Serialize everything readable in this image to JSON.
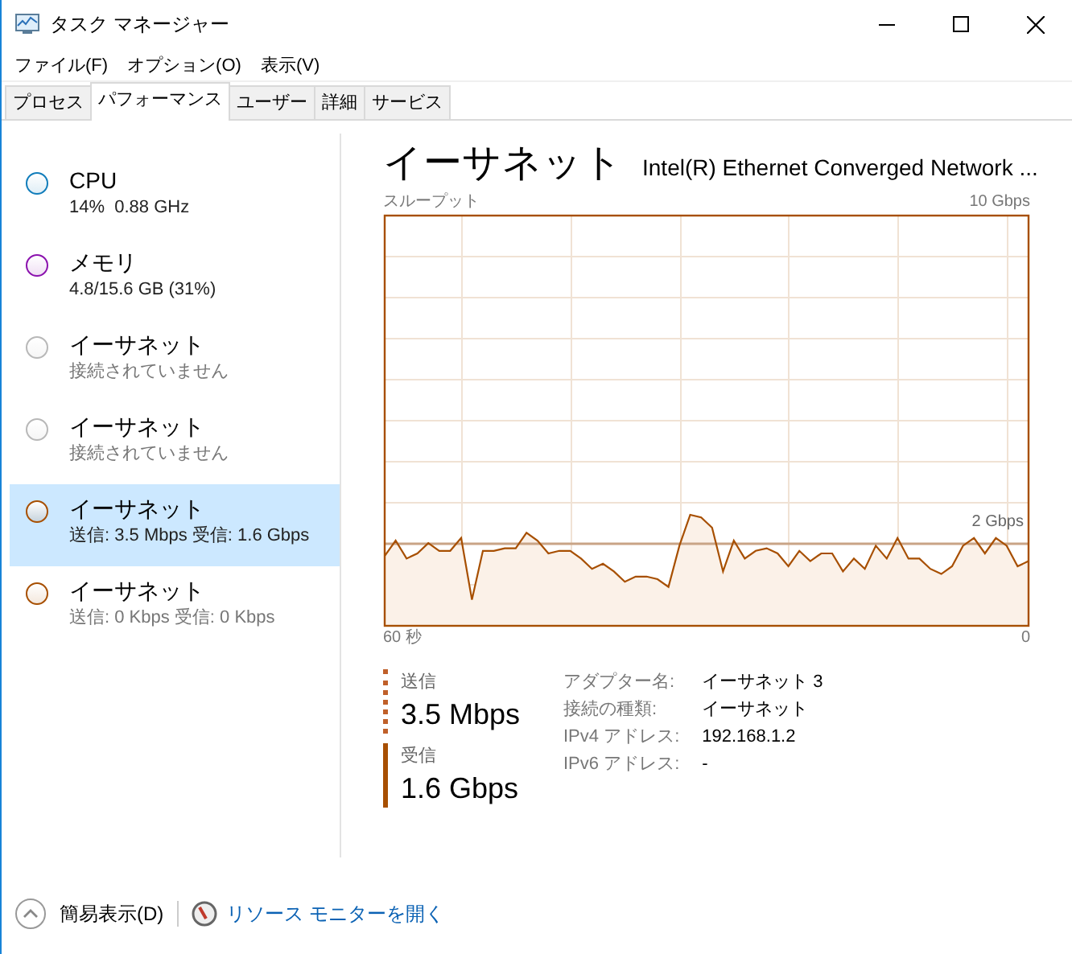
{
  "window": {
    "title": "タスク マネージャー"
  },
  "menu": [
    "ファイル(F)",
    "オプション(O)",
    "表示(V)"
  ],
  "tabs": [
    {
      "label": "プロセス",
      "selected": false
    },
    {
      "label": "パフォーマンス",
      "selected": true
    },
    {
      "label": "ユーザー",
      "selected": false
    },
    {
      "label": "詳細",
      "selected": false
    },
    {
      "label": "サービス",
      "selected": false
    }
  ],
  "sidebar": {
    "items": [
      {
        "name": "CPU",
        "detail": "14%  0.88 GHz",
        "color": "#117dbb",
        "muted": false,
        "selected": false
      },
      {
        "name": "メモリ",
        "detail": "4.8/15.6 GB (31%)",
        "color": "#8b12ae",
        "muted": false,
        "selected": false
      },
      {
        "name": "イーサネット",
        "detail": "接続されていません",
        "color": "#b8b8b8",
        "muted": true,
        "selected": false
      },
      {
        "name": "イーサネット",
        "detail": "接続されていません",
        "color": "#b8b8b8",
        "muted": true,
        "selected": false
      },
      {
        "name": "イーサネット",
        "detail": "送信: 3.5 Mbps 受信: 1.6 Gbps",
        "color": "#a74f01",
        "muted": false,
        "selected": true
      },
      {
        "name": "イーサネット",
        "detail": "送信: 0 Kbps 受信: 0 Kbps",
        "color": "#a74f01",
        "muted": true,
        "selected": false
      }
    ]
  },
  "panel": {
    "title": "イーサネット",
    "subtitle": "Intel(R) Ethernet Converged Network ...",
    "graph": {
      "label": "スループット",
      "max": "10 Gbps",
      "line_label": "2 Gbps",
      "x_start": "60 秒",
      "x_end": "0"
    },
    "legend": [
      {
        "label": "送信",
        "value": "3.5 Mbps",
        "kind": "dotted"
      },
      {
        "label": "受信",
        "value": "1.6 Gbps",
        "kind": "solid"
      }
    ],
    "details": [
      {
        "label": "アダプター名:",
        "value": "イーサネット 3"
      },
      {
        "label": "接続の種類:",
        "value": "イーサネット"
      },
      {
        "label": "IPv4 アドレス:",
        "value": "192.168.1.2"
      },
      {
        "label": "IPv6 アドレス:",
        "value": "-"
      }
    ]
  },
  "footer": {
    "toggle": "簡易表示(D)",
    "link": "リソース モニターを開く"
  }
}
